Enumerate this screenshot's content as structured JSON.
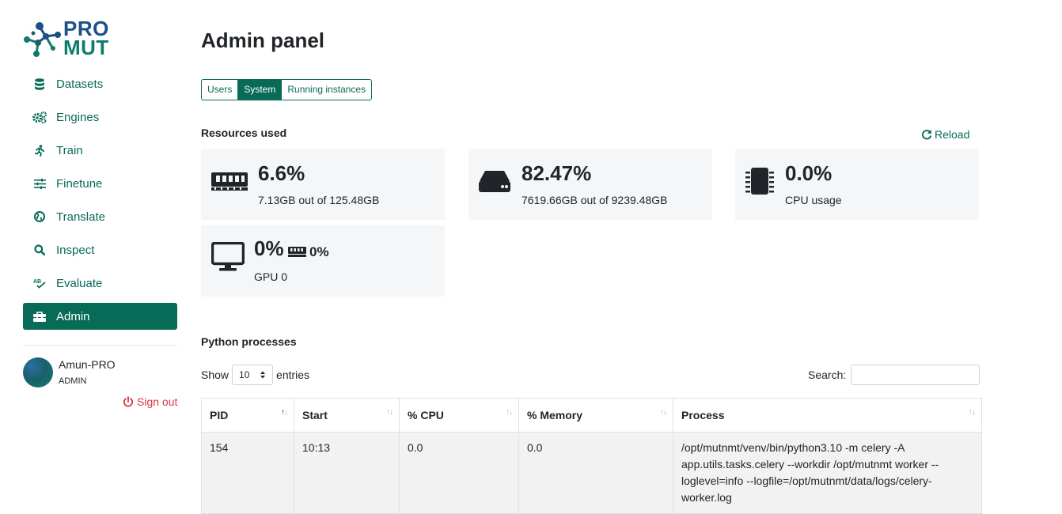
{
  "logo": {
    "line1": "PRO",
    "line2": "MUT"
  },
  "nav": [
    {
      "label": "Datasets",
      "icon": "database-icon"
    },
    {
      "label": "Engines",
      "icon": "gears-icon"
    },
    {
      "label": "Train",
      "icon": "running-icon"
    },
    {
      "label": "Finetune",
      "icon": "sliders-icon"
    },
    {
      "label": "Translate",
      "icon": "globe-icon"
    },
    {
      "label": "Inspect",
      "icon": "search-icon"
    },
    {
      "label": "Evaluate",
      "icon": "spellcheck-icon"
    },
    {
      "label": "Admin",
      "icon": "toolbox-icon",
      "active": true
    }
  ],
  "user": {
    "name": "Amun-PRO",
    "role": "ADMIN",
    "signout": "Sign out"
  },
  "page": {
    "title": "Admin panel"
  },
  "tabs": [
    {
      "label": "Users"
    },
    {
      "label": "System",
      "active": true
    },
    {
      "label": "Running instances"
    }
  ],
  "resources": {
    "title": "Resources used",
    "reload": "Reload",
    "ram": {
      "percent": "6.6%",
      "detail": "7.13GB out of 125.48GB"
    },
    "disk": {
      "percent": "82.47%",
      "detail": "7619.66GB out of 9239.48GB"
    },
    "cpu": {
      "percent": "0.0%",
      "detail": "CPU usage"
    },
    "gpu": {
      "percent": "0%",
      "mem_percent": "0%",
      "detail": "GPU 0"
    }
  },
  "processes": {
    "title": "Python processes",
    "show": "Show",
    "entries": "entries",
    "page_length": "10",
    "search_label": "Search:",
    "columns": [
      "PID",
      "Start",
      "% CPU",
      "% Memory",
      "Process"
    ],
    "rows": [
      {
        "pid": "154",
        "start": "10:13",
        "cpu": "0.0",
        "memory": "0.0",
        "process": "/opt/mutnmt/venv/bin/python3.10 -m celery -A app.utils.tasks.celery --workdir /opt/mutnmt worker --loglevel=info --logfile=/opt/mutnmt/data/logs/celery-worker.log"
      }
    ]
  },
  "colors": {
    "primary": "#086b57",
    "danger": "#dc3545",
    "card_bg": "#f5f6f7"
  }
}
